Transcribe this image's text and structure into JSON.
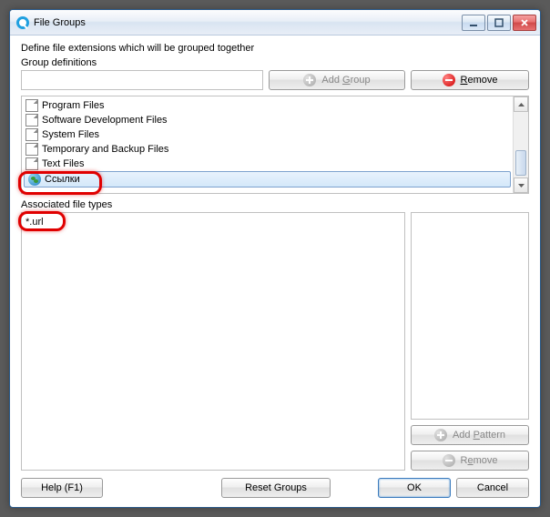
{
  "window": {
    "title": "File Groups"
  },
  "description": "Define file extensions which will be grouped together",
  "group_definitions_label": "Group definitions",
  "buttons": {
    "add_group": "Add Group",
    "remove": "Remove",
    "add_pattern": "Add Pattern",
    "remove2": "Remove",
    "help": "Help (F1)",
    "reset": "Reset Groups",
    "ok": "OK",
    "cancel": "Cancel"
  },
  "groups": [
    "Program Files",
    "Software Development Files",
    "System Files",
    "Temporary and Backup Files",
    "Text Files",
    "Ссылки"
  ],
  "assoc_label": "Associated file types",
  "assoc_items": [
    "*.url"
  ]
}
